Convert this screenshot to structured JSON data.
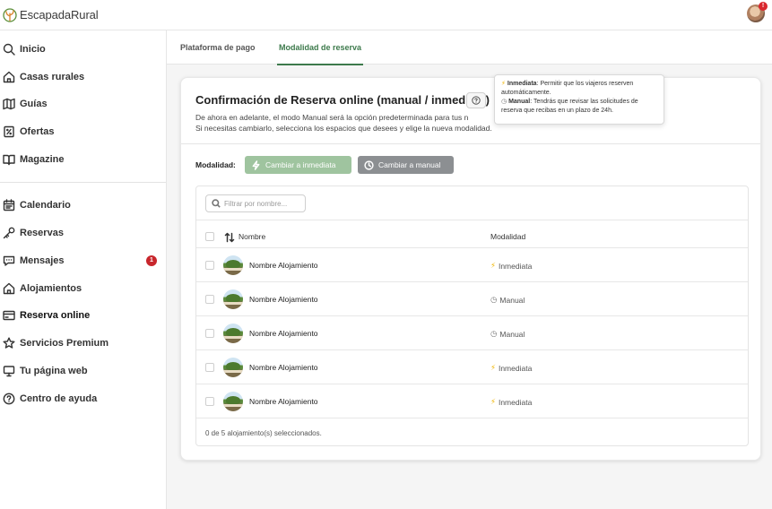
{
  "app": {
    "brand": "EscapadaRural",
    "notification_count": "!"
  },
  "colors": {
    "accent": "#3d7a4c",
    "immediate_button": "#9fc49f",
    "manual_button": "#8c8f92",
    "badge": "#c8262c"
  },
  "sidebar": {
    "items": [
      {
        "label": "Inicio",
        "icon": "search-icon"
      },
      {
        "label": "Casas rurales",
        "icon": "home-icon"
      },
      {
        "label": "Guías",
        "icon": "map-icon"
      },
      {
        "label": "Ofertas",
        "icon": "tag-icon"
      },
      {
        "label": "Magazine",
        "icon": "book-icon"
      },
      {
        "label": "Calendario",
        "icon": "calendar-icon"
      },
      {
        "label": "Reservas",
        "icon": "key-icon"
      },
      {
        "label": "Mensajes",
        "icon": "chat-icon",
        "badge": "1"
      },
      {
        "label": "Alojamientos",
        "icon": "house-icon"
      },
      {
        "label": "Reserva online",
        "icon": "card-icon",
        "active": true
      },
      {
        "label": "Servicios Premium",
        "icon": "star-icon"
      },
      {
        "label": "Tu página web",
        "icon": "monitor-icon"
      },
      {
        "label": "Centro de ayuda",
        "icon": "help-icon"
      }
    ]
  },
  "tabs": [
    {
      "label": "Plataforma de pago",
      "active": false
    },
    {
      "label": "Modalidad de reserva",
      "active": true
    }
  ],
  "card": {
    "title": "Confirmación de Reserva online (manual / inmediata)",
    "desc_line1": "De ahora en adelante, el modo Manual será la opción predeterminada para tus n",
    "desc_line2": "Si necesitas cambiarlo, selecciona los espacios que desees y elige la nueva modalidad."
  },
  "tooltip": {
    "immediate_title": "Inmediata",
    "immediate_text": ": Permitir que los viajeros reserven automáticamente.",
    "manual_title": "Manual",
    "manual_text": ": Tendrás que revisar las solicitudes de reserva que recibas en un plazo de 24h."
  },
  "controls": {
    "mode_label": "Modalidad:",
    "to_immediate": "Cambiar a inmediata",
    "to_manual": "Cambiar a manual"
  },
  "table": {
    "filter_placeholder": "Filtrar por nombre...",
    "col_name": "Nombre",
    "col_mode": "Modalidad",
    "rows": [
      {
        "name": "Nombre Alojamiento",
        "mode": "Inmediata",
        "icon": "bolt-icon"
      },
      {
        "name": "Nombre Alojamiento",
        "mode": "Manual",
        "icon": "clock-icon"
      },
      {
        "name": "Nombre Alojamiento",
        "mode": "Manual",
        "icon": "clock-icon"
      },
      {
        "name": "Nombre Alojamiento",
        "mode": "Inmediata",
        "icon": "bolt-icon"
      },
      {
        "name": "Nombre Alojamiento",
        "mode": "Inmediata",
        "icon": "bolt-icon"
      }
    ],
    "footer": "0 de 5 alojamiento(s) seleccionados."
  }
}
